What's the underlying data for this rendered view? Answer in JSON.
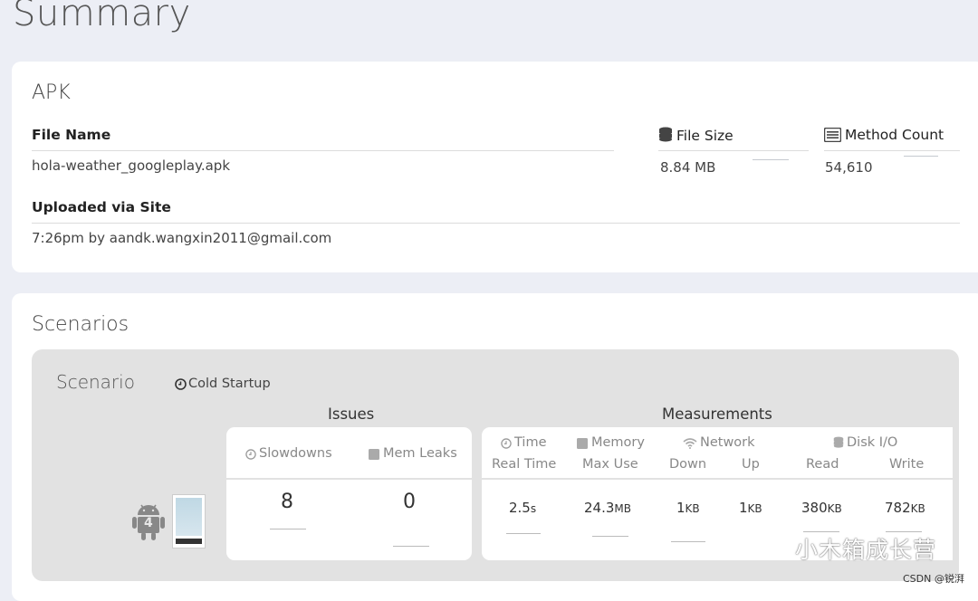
{
  "page": {
    "title": "Summary"
  },
  "apk": {
    "heading": "APK",
    "file_name_label": "File Name",
    "file_name": "hola-weather_googleplay.apk",
    "file_size_label": "File Size",
    "file_size": "8.84 MB",
    "method_count_label": "Method Count",
    "method_count": "54,610",
    "uploaded_label": "Uploaded via Site",
    "uploaded_value": "7:26pm by aandk.wangxin2011@gmail.com"
  },
  "scenarios": {
    "heading": "Scenarios",
    "scenario_label": "Scenario",
    "scenario_name": "Cold Startup",
    "device_badge": "4",
    "issues": {
      "title": "Issues",
      "slowdowns_label": "Slowdowns",
      "mem_leaks_label": "Mem Leaks",
      "slowdowns": "8",
      "mem_leaks": "0"
    },
    "measurements": {
      "title": "Measurements",
      "time_label": "Time",
      "time_sub": "Real Time",
      "memory_label": "Memory",
      "memory_sub": "Max Use",
      "network_label": "Network",
      "down_label": "Down",
      "up_label": "Up",
      "disk_label": "Disk I/O",
      "read_label": "Read",
      "write_label": "Write",
      "real_time": "2.5",
      "real_time_unit": "s",
      "max_use": "24.3",
      "max_use_unit": "MB",
      "down": "1",
      "down_unit": "KB",
      "up": "1",
      "up_unit": "KB",
      "read": "380",
      "read_unit": "KB",
      "write": "782",
      "write_unit": "KB"
    }
  },
  "watermark": {
    "text": "小木箱成长营",
    "credit": "CSDN @锐湃"
  }
}
